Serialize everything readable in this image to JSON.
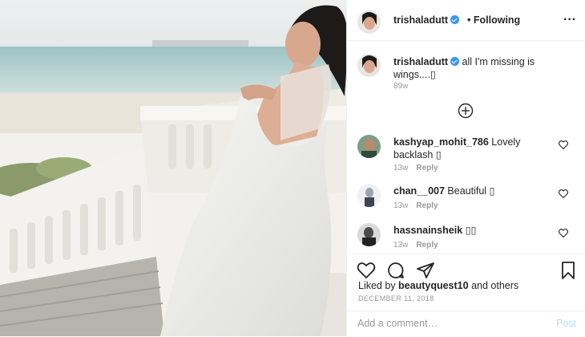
{
  "post": {
    "username": "trishaladutt",
    "follow_status": "Following",
    "separator": "•",
    "more_icon": "more-icon",
    "verified_icon": "verified-badge-icon",
    "caption": "all I'm missing is wings....",
    "caption_emoji": "▯",
    "age": "89w",
    "load_more_icon": "plus-circle-icon"
  },
  "comments": [
    {
      "username": "kashyap_mohit_786",
      "text": "Lovely backlash ▯",
      "age": "13w",
      "reply": "Reply"
    },
    {
      "username": "chan__007",
      "text": "Beautiful ▯",
      "age": "13w",
      "reply": "Reply"
    },
    {
      "username": "hassnainsheik",
      "text": "▯▯",
      "age": "13w",
      "reply": "Reply"
    }
  ],
  "actions": {
    "liked_by_prefix": "Liked by",
    "liked_by_user": "beautyquest10",
    "liked_by_suffix": "and others",
    "date": "DECEMBER 11, 2018",
    "add_comment_placeholder": "Add a comment…",
    "post_label": "Post"
  },
  "colors": {
    "accent": "#3897f0",
    "post_disabled": "#b2dffc",
    "muted": "#999999",
    "text": "#262626"
  }
}
